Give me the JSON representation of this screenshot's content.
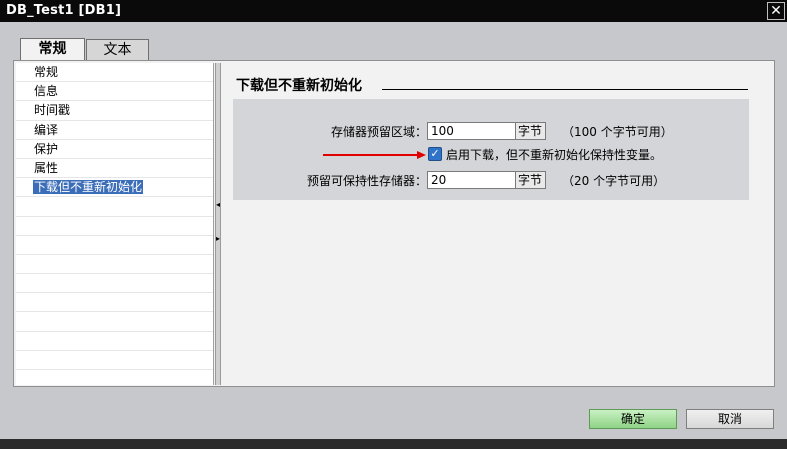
{
  "window": {
    "title": "DB_Test1 [DB1]",
    "close_glyph": "✕"
  },
  "tabs": [
    {
      "label": "常规",
      "active": true
    },
    {
      "label": "文本",
      "active": false
    }
  ],
  "nav": {
    "items": [
      {
        "label": "常规"
      },
      {
        "label": "信息"
      },
      {
        "label": "时间戳"
      },
      {
        "label": "编译"
      },
      {
        "label": "保护"
      },
      {
        "label": "属性"
      },
      {
        "label": "下载但不重新初始化",
        "selected": true
      }
    ]
  },
  "section": {
    "title": "下载但不重新初始化"
  },
  "form": {
    "memory_reserve": {
      "label": "存储器预留区域：",
      "value": "100",
      "unit": "字节",
      "note": "（100 个字节可用）"
    },
    "enable_download": {
      "label": "启用下载，但不重新初始化保持性变量。",
      "checked": true,
      "check_glyph": "✓"
    },
    "retain_reserve": {
      "label": "预留可保持性存储器：",
      "value": "20",
      "unit": "字节",
      "note": "（20 个字节可用）"
    }
  },
  "buttons": {
    "ok": "确定",
    "cancel": "取消"
  },
  "colors": {
    "accent": "#2f74c9",
    "annotation_arrow": "#e00000",
    "ok_button": "#a8e29f"
  },
  "icons": {
    "splitter_left": "◂",
    "splitter_right": "▸"
  }
}
